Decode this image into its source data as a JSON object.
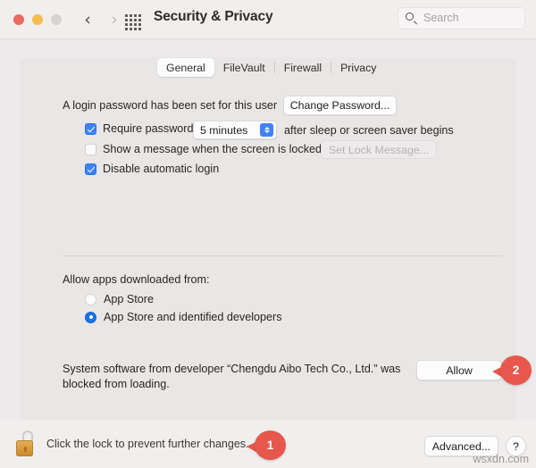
{
  "window": {
    "title": "Security & Privacy",
    "traffic_lights": [
      "close",
      "minimize",
      "maximize"
    ],
    "nav": {
      "back": "‹",
      "forward": "›"
    },
    "grid_icon": "apps-grid-icon"
  },
  "search": {
    "placeholder": "Search",
    "value": ""
  },
  "tabs": [
    {
      "label": "General",
      "selected": true
    },
    {
      "label": "FileVault",
      "selected": false
    },
    {
      "label": "Firewall",
      "selected": false
    },
    {
      "label": "Privacy",
      "selected": false
    }
  ],
  "general": {
    "password_status": "A login password has been set for this user",
    "change_password_button": "Change Password...",
    "require_password": {
      "label_before": "Require password",
      "checked": true,
      "interval": "5 minutes",
      "label_after": "after sleep or screen saver begins"
    },
    "show_message": {
      "label": "Show a message when the screen is locked",
      "checked": false,
      "button": "Set Lock Message...",
      "button_disabled": true
    },
    "disable_auto_login": {
      "label": "Disable automatic login",
      "checked": true
    }
  },
  "gatekeeper": {
    "heading": "Allow apps downloaded from:",
    "options": [
      {
        "label": "App Store",
        "selected": false
      },
      {
        "label": "App Store and identified developers",
        "selected": true
      }
    ]
  },
  "blocked_software": {
    "message": "System software from developer “Chengdu Aibo Tech Co., Ltd.” was blocked from loading.",
    "allow_button": "Allow"
  },
  "bottom": {
    "lock_icon": "unlocked-padlock-icon",
    "lock_text": "Click the lock to prevent further changes.",
    "advanced_button": "Advanced...",
    "help_button": "?"
  },
  "annotations": [
    {
      "number": "1",
      "color": "#e8574c"
    },
    {
      "number": "2",
      "color": "#e8574c"
    }
  ],
  "watermark": "wsxdn.com",
  "colors": {
    "accent_blue": "#3e82f5",
    "radio_blue": "#1473e6",
    "annotation_red": "#e8574c",
    "window_bg": "#f1eeee",
    "panel_bg": "#e9e6e6"
  }
}
